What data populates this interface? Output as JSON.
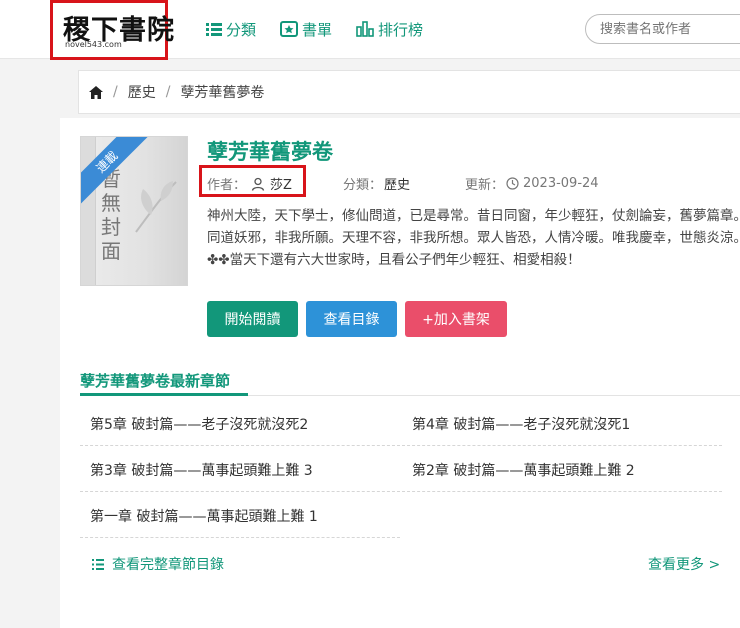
{
  "header": {
    "logo_text": "稷下書院",
    "logo_sub": "novel543.com",
    "nav": [
      {
        "label": "分類",
        "icon": "list-icon"
      },
      {
        "label": "書單",
        "icon": "star-book-icon"
      },
      {
        "label": "排行榜",
        "icon": "bar-chart-icon"
      }
    ],
    "search_placeholder": "搜索書名或作者"
  },
  "breadcrumb": {
    "home_icon": "home-icon",
    "items": [
      "歷史",
      "孽芳華舊夢卷"
    ]
  },
  "book": {
    "cover_text": "暫無封面",
    "ribbon": "連載",
    "title": "孽芳華舊夢卷",
    "author_label": "作者：",
    "author": "莎Z",
    "category_label": "分類：",
    "category": "歷史",
    "updated_label": "更新：",
    "updated": "2023-09-24",
    "description": "神州大陸，天下學士，修仙問道，已是尋常。昔日同窗，年少輕狂，仗劍論妄，舊夢篇章。同道妖邪，非我所願。天理不容，非我所想。眾人皆恐，人情冷暖。唯我慶幸，世態炎涼。✤✤當天下還有六大世家時，且看公子們年少輕狂、相愛相殺！"
  },
  "actions": {
    "read": "開始閱讀",
    "toc": "查看目錄",
    "shelf": "+加入書架"
  },
  "latest": {
    "title": "孽芳華舊夢卷最新章節",
    "chapters": [
      "第5章 破封篇——老子沒死就沒死2",
      "第4章 破封篇——老子沒死就沒死1",
      "第3章 破封篇——萬事起頭難上難 3",
      "第2章 破封篇——萬事起頭難上難 2",
      "第一章 破封篇——萬事起頭難上難 1"
    ],
    "full_list": "查看完整章節目錄",
    "more": "查看更多 >"
  },
  "colors": {
    "accent": "#12977a",
    "toc_button": "#2d92d8",
    "shelf_button": "#ea4e6a",
    "highlight": "#d8141a"
  }
}
